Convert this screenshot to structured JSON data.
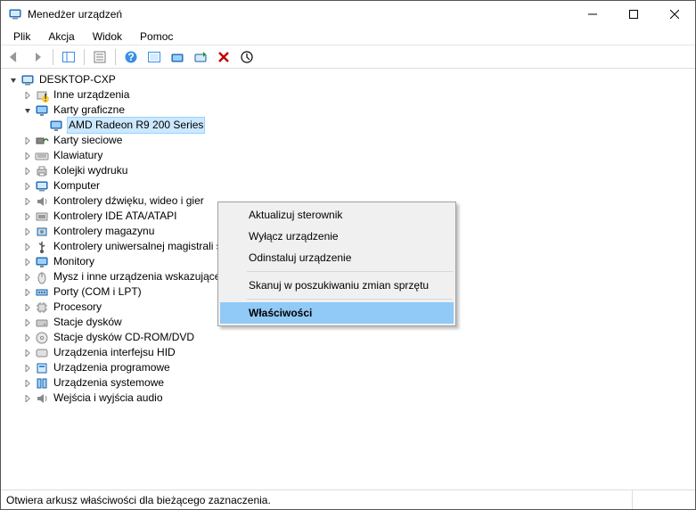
{
  "window": {
    "title": "Menedżer urządzeń"
  },
  "menu": {
    "file": "Plik",
    "action": "Akcja",
    "view": "Widok",
    "help": "Pomoc"
  },
  "tree": {
    "root": "DESKTOP-CXP",
    "categories": [
      {
        "label": "Inne urządzenia",
        "expanded": false
      },
      {
        "label": "Karty graficzne",
        "expanded": true,
        "children": [
          {
            "label": "AMD Radeon R9 200 Series",
            "selected": true
          }
        ]
      },
      {
        "label": "Karty sieciowe",
        "expanded": false
      },
      {
        "label": "Klawiatury",
        "expanded": false
      },
      {
        "label": "Kolejki wydruku",
        "expanded": false
      },
      {
        "label": "Komputer",
        "expanded": false
      },
      {
        "label": "Kontrolery dźwięku, wideo i gier",
        "expanded": false
      },
      {
        "label": "Kontrolery IDE ATA/ATAPI",
        "expanded": false
      },
      {
        "label": "Kontrolery magazynu",
        "expanded": false
      },
      {
        "label": "Kontrolery uniwersalnej magistrali szeregowej",
        "expanded": false
      },
      {
        "label": "Monitory",
        "expanded": false
      },
      {
        "label": "Mysz i inne urządzenia wskazujące",
        "expanded": false
      },
      {
        "label": "Porty (COM i LPT)",
        "expanded": false
      },
      {
        "label": "Procesory",
        "expanded": false
      },
      {
        "label": "Stacje dysków",
        "expanded": false
      },
      {
        "label": "Stacje dysków CD-ROM/DVD",
        "expanded": false
      },
      {
        "label": "Urządzenia interfejsu HID",
        "expanded": false
      },
      {
        "label": "Urządzenia programowe",
        "expanded": false
      },
      {
        "label": "Urządzenia systemowe",
        "expanded": false
      },
      {
        "label": "Wejścia i wyjścia audio",
        "expanded": false
      }
    ]
  },
  "contextmenu": {
    "items": [
      "Aktualizuj sterownik",
      "Wyłącz urządzenie",
      "Odinstaluj urządzenie",
      "Skanuj w poszukiwaniu zmian sprzętu",
      "Właściwości"
    ]
  },
  "statusbar": {
    "text": "Otwiera arkusz właściwości dla bieżącego zaznaczenia."
  }
}
